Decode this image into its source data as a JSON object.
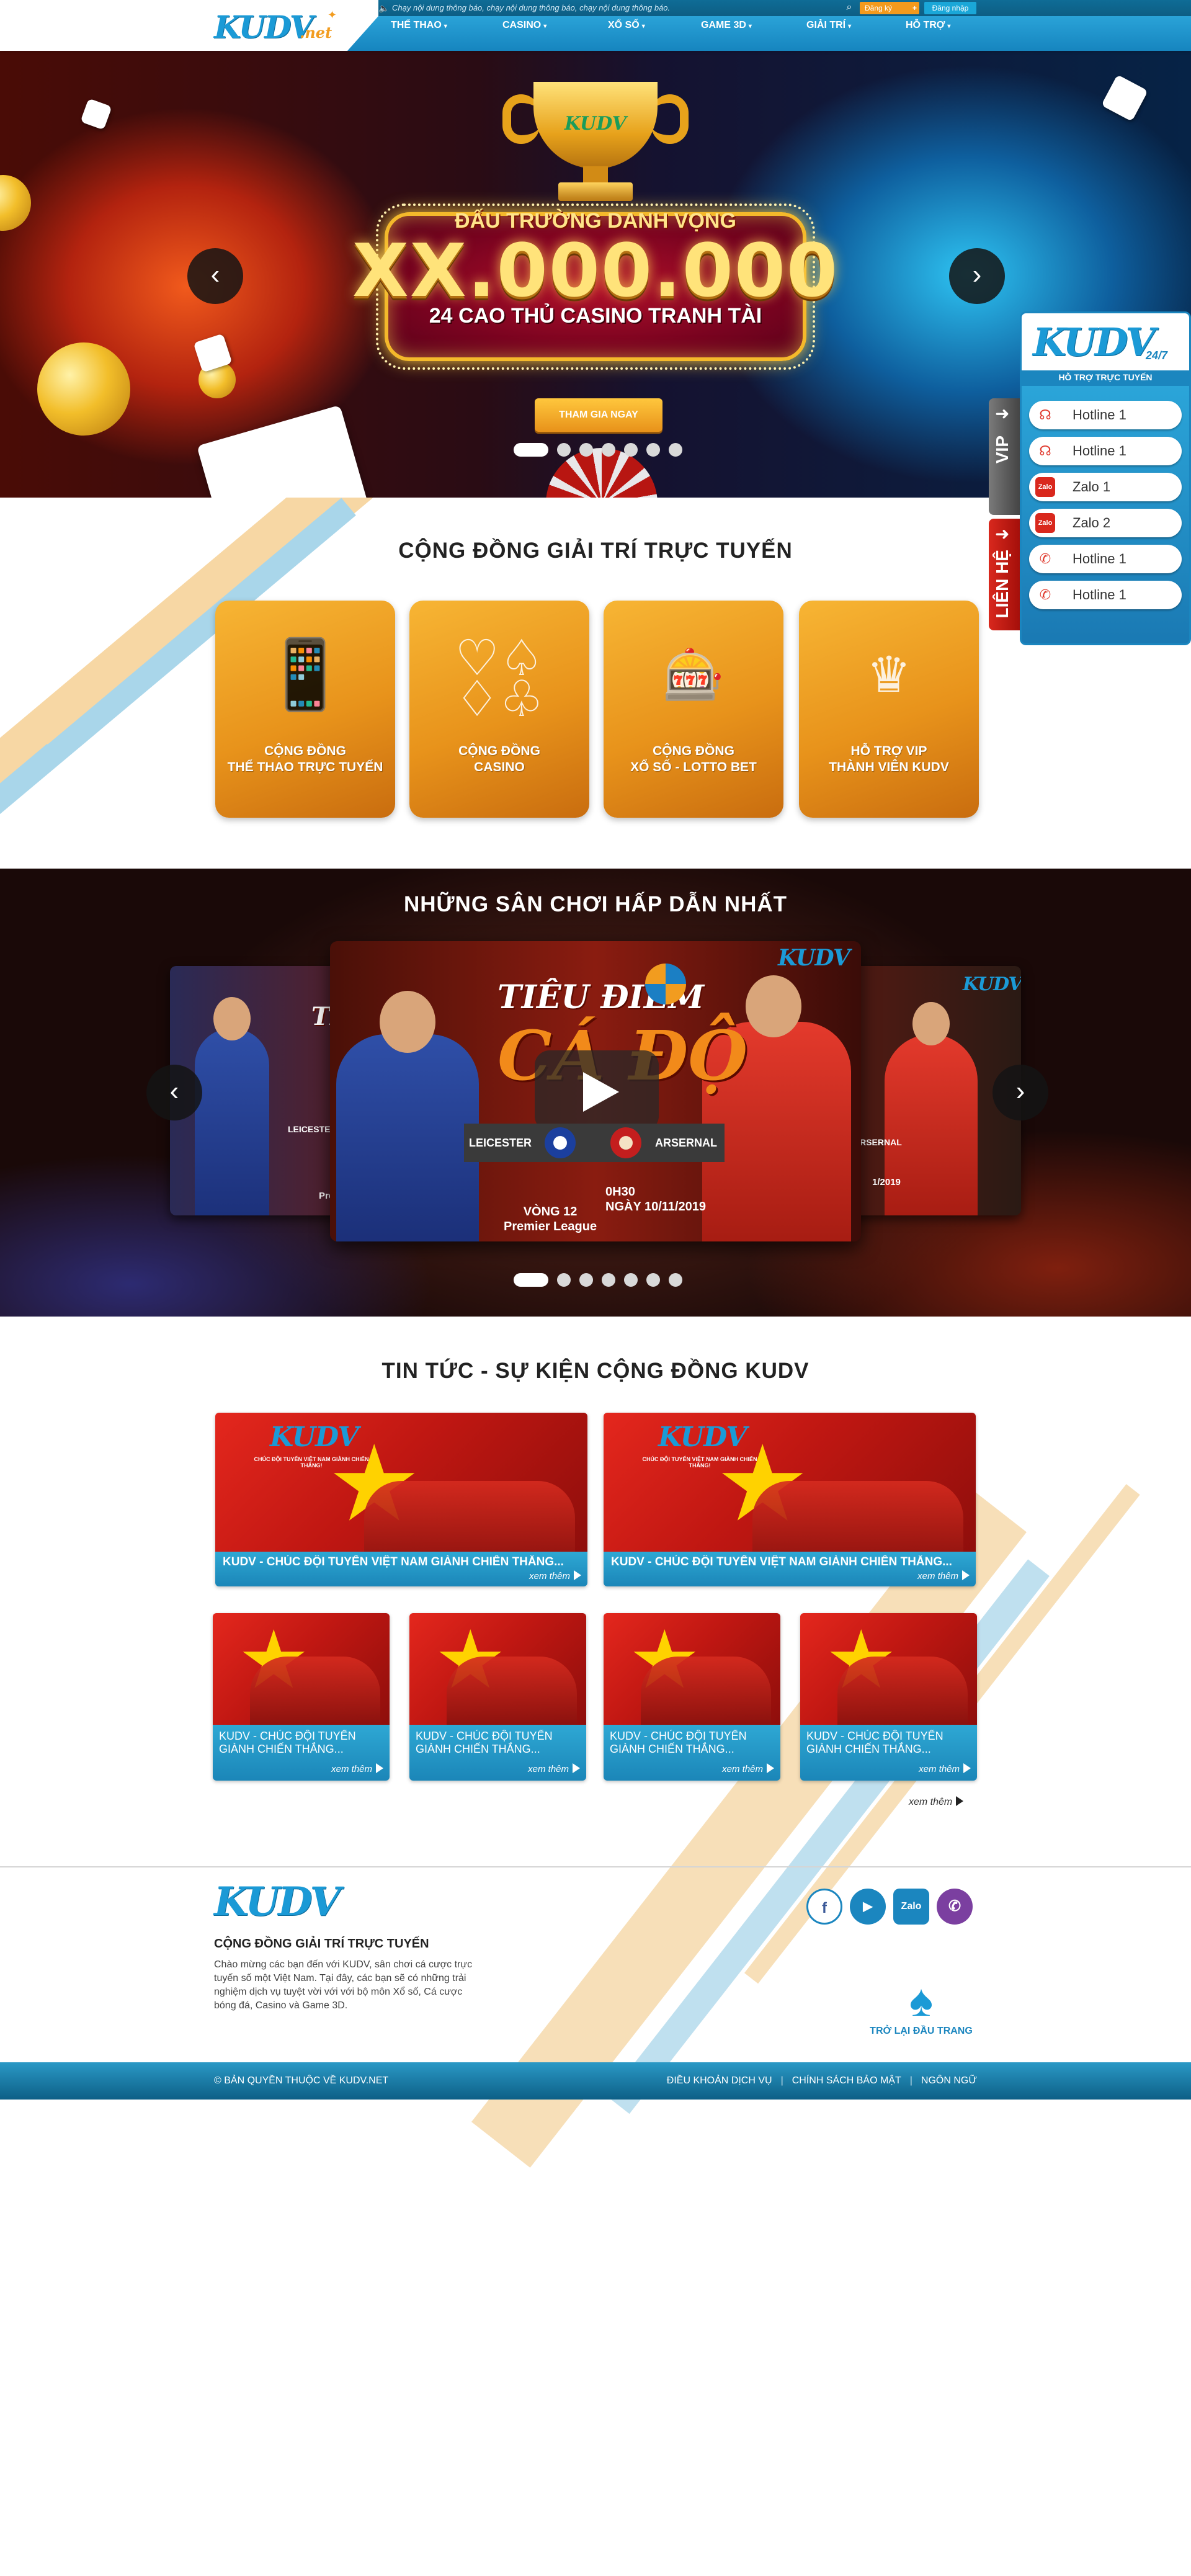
{
  "header": {
    "logo_text": "KUDV",
    "logo_suffix": ".net",
    "notice": "Chạy nội dung thông báo, chạy nội dung thông báo, chạy nội dung thông báo.",
    "register_label": "Đăng ký",
    "login_label": "Đăng nhập",
    "nav": [
      {
        "label": "THỂ THAO"
      },
      {
        "label": "CASINO"
      },
      {
        "label": "XỔ SỐ"
      },
      {
        "label": "GAME 3D"
      },
      {
        "label": "GIẢI TRÍ"
      },
      {
        "label": "HỖ TRỢ"
      }
    ]
  },
  "hero": {
    "trophy_logo": "KUDV",
    "title": "ĐẤU TRƯỜNG DANH VỌNG",
    "big": "XX.000.000",
    "sub": "24 CAO THỦ CASINO TRANH TÀI",
    "cta": "THAM GIA NGAY",
    "prev": "‹",
    "next": "›",
    "slide_count": 7,
    "active_slide": 1
  },
  "support": {
    "logo": "KUDV",
    "hours": "24/7",
    "label": "HỖ TRỢ TRỰC TUYẾN",
    "vip_tab": "VIP",
    "contact_tab": "LIÊN HỆ",
    "items": [
      {
        "label": "Hotline 1",
        "icon": "headset-icon"
      },
      {
        "label": "Hotline 1",
        "icon": "headset-icon"
      },
      {
        "label": "Zalo 1",
        "icon": "zalo-icon"
      },
      {
        "label": "Zalo 2",
        "icon": "zalo-icon"
      },
      {
        "label": "Hotline 1",
        "icon": "whatsapp-icon"
      },
      {
        "label": "Hotline 1",
        "icon": "whatsapp-icon"
      }
    ]
  },
  "community": {
    "title": "CỘNG ĐỒNG GIẢI TRÍ TRỰC TUYẾN",
    "tiles": [
      {
        "line1": "CỘNG ĐỒNG",
        "line2": "THỂ THAO TRỰC TUYẾN",
        "icon": "phone-sports-icon"
      },
      {
        "line1": "CỘNG ĐỒNG",
        "line2": "CASINO",
        "icon": "card-suits-icon"
      },
      {
        "line1": "CỘNG ĐỒNG",
        "line2": "XỔ SỐ - LOTTO BET",
        "icon": "slot-machine-icon"
      },
      {
        "line1": "HỖ TRỢ VIP",
        "line2": "THÀNH VIÊN KUDV",
        "icon": "vip-support-icon"
      }
    ]
  },
  "games": {
    "title": "NHỮNG SÂN CHƠI HẤP DẪN NHẤT",
    "slide": {
      "logo": "KUDV",
      "tieu_diem": "TIÊU ĐIỂM",
      "ca_do": "CÁ ĐỘ",
      "team_home": "LEICESTER",
      "team_away": "ARSERNAL",
      "time": "0H30",
      "date": "NGÀY 10/11/2019",
      "round": "VÒNG 12",
      "league": "Premier League",
      "left_partial_title": "TI",
      "left_partial_team": "LEICESTER",
      "left_partial_league": "Prem",
      "right_partial_team": "ARSERNAL",
      "right_partial_date": "1/2019"
    },
    "prev": "‹",
    "next": "›",
    "slide_count": 7,
    "active_slide": 1
  },
  "news": {
    "title": "TIN TỨC - SỰ KIỆN CỘNG ĐỒNG KUDV",
    "image_logo": "KUDV",
    "image_caption": "CHÚC ĐỘI TUYỂN VIỆT NAM GIÀNH CHIẾN THẮNG!",
    "big": [
      {
        "title": "KUDV - CHÚC ĐỘI TUYỂN VIỆT NAM GIÀNH CHIẾN THẮNG...",
        "more": "xem thêm"
      },
      {
        "title": "KUDV - CHÚC ĐỘI TUYỂN VIỆT NAM GIÀNH CHIẾN THẮNG...",
        "more": "xem thêm"
      }
    ],
    "small": [
      {
        "title": "KUDV - CHÚC ĐỘI TUYỂN GIÀNH CHIẾN THẮNG...",
        "more": "xem thêm"
      },
      {
        "title": "KUDV - CHÚC ĐỘI TUYỂN GIÀNH CHIẾN THẮNG...",
        "more": "xem thêm"
      },
      {
        "title": "KUDV - CHÚC ĐỘI TUYỂN GIÀNH CHIẾN THẮNG...",
        "more": "xem thêm"
      },
      {
        "title": "KUDV - CHÚC ĐỘI TUYỂN GIÀNH CHIẾN THẮNG...",
        "more": "xem thêm"
      }
    ],
    "view_all": "xem thêm"
  },
  "footer": {
    "logo": "KUDV",
    "heading": "CỘNG ĐỒNG GIẢI TRÍ TRỰC TUYẾN",
    "text": "Chào mừng các bạn đến với KUDV, sân chơi cá cược trực tuyến số một Việt Nam. Tại đây, các bạn sẽ có những trải nghiệm dịch vụ tuyệt vời với với bộ môn Xổ số, Cá cược bóng đá, Casino và Game 3D.",
    "social": [
      {
        "label": "f",
        "icon": "facebook-icon",
        "color": "#3b5998"
      },
      {
        "label": "▶",
        "icon": "youtube-icon",
        "color": "#1b86bf"
      },
      {
        "label": "Zalo",
        "icon": "zalo-icon",
        "color": "#1b86bf"
      },
      {
        "label": "✆",
        "icon": "viber-icon",
        "color": "#7b3fa0"
      }
    ],
    "back_to_top": "TRỞ LẠI ĐẦU TRANG",
    "copyright": "© BẢN QUYỀN THUỘC VỀ KUDV.NET",
    "links": [
      "ĐIỀU KHOẢN DỊCH VỤ",
      "CHÍNH SÁCH BẢO MẬT",
      "NGÔN NGỮ"
    ],
    "link_sep": "|"
  },
  "colors": {
    "brand_blue": "#1b9ad6",
    "brand_orange": "#f29c1f",
    "nav_blue": "#1685bf",
    "tile_orange": "#e8931b"
  }
}
